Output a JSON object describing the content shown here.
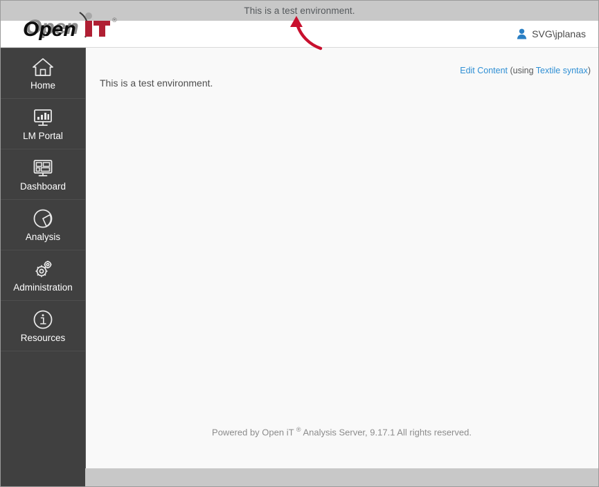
{
  "banner": {
    "text": "This is a test environment."
  },
  "header": {
    "logo": {
      "word_mark": "Open",
      "accent_mark": "iT",
      "registered": "®",
      "name": "open-it-logo"
    },
    "user": {
      "icon": "user-icon",
      "name": "SVG\\jplanas"
    }
  },
  "sidebar": {
    "items": [
      {
        "label": "Home",
        "icon": "home-icon"
      },
      {
        "label": "LM Portal",
        "icon": "monitor-chart-icon"
      },
      {
        "label": "Dashboard",
        "icon": "dashboard-grid-icon"
      },
      {
        "label": "Analysis",
        "icon": "pie-chart-icon"
      },
      {
        "label": "Administration",
        "icon": "gears-icon"
      },
      {
        "label": "Resources",
        "icon": "info-circle-icon"
      }
    ]
  },
  "content": {
    "edit": {
      "link_label": "Edit Content",
      "prefix": " (using ",
      "syntax_link_label": "Textile syntax",
      "suffix": ")"
    },
    "body_text": "This is a test environment.",
    "footer": {
      "prefix": "Powered by Open iT ",
      "registered": "®",
      "suffix": " Analysis Server, 9.17.1 All rights reserved."
    }
  },
  "annotation": {
    "name": "red-curved-arrow",
    "color": "#c8102e",
    "points_to": "test-environment-banner"
  },
  "colors": {
    "banner_bg": "#c8c8c8",
    "sidebar_bg": "#404040",
    "content_bg": "#f9f9f9",
    "link": "#2f8fd4",
    "logo_accent": "#b01f33",
    "user_icon": "#2a7fc4"
  }
}
